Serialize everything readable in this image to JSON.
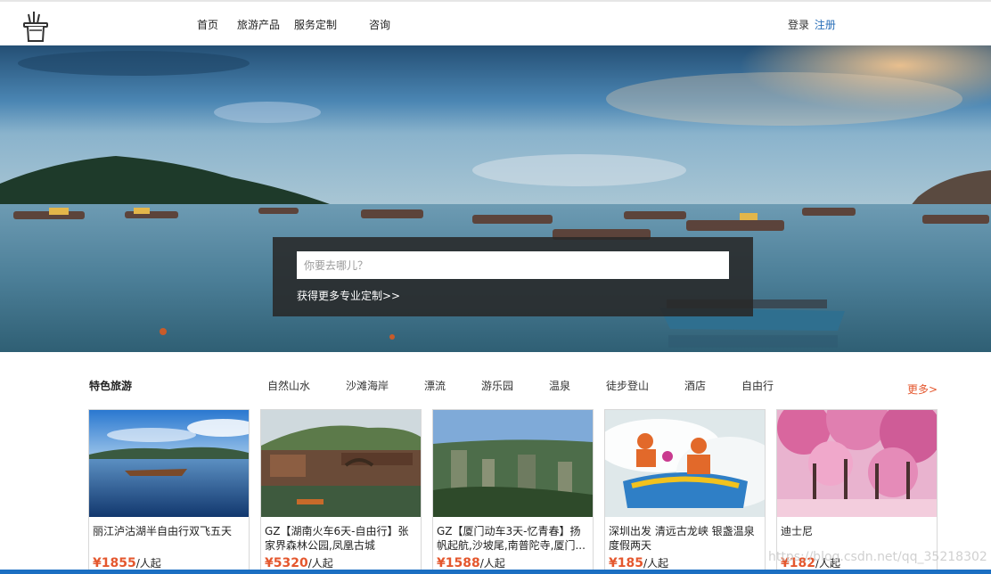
{
  "header": {
    "logo_icon": "magic-hat-icon",
    "nav": [
      "首页",
      "旅游产品",
      "服务定制",
      "咨询"
    ],
    "login": "登录",
    "register": "注册"
  },
  "hero": {
    "search_placeholder": "你要去哪儿？",
    "more_custom": "获得更多专业定制>>"
  },
  "section": {
    "title": "特色旅游",
    "categories": [
      "自然山水",
      "沙滩海岸",
      "漂流",
      "游乐园",
      "温泉",
      "徒步登山",
      "酒店",
      "自由行"
    ],
    "more": "更多>"
  },
  "cards": [
    {
      "title": "丽江泸沽湖半自由行双飞五天",
      "price": "¥1855",
      "unit": "/人起"
    },
    {
      "title": "GZ【湖南火车6天-自由行】张家界森林公园,凤凰古城",
      "price": "¥5320",
      "unit": "/人起"
    },
    {
      "title": "GZ【厦门动车3天-忆青春】扬帆起航,沙坡尾,南普陀寺,厦门...",
      "price": "¥1588",
      "unit": "/人起"
    },
    {
      "title": "深圳出发 清远古龙峡 银盏温泉度假两天",
      "price": "¥185",
      "unit": "/人起"
    },
    {
      "title": "迪士尼",
      "price": "¥182",
      "unit": "/人起"
    }
  ],
  "watermark": "https://blog.csdn.net/qq_35218302",
  "colors": {
    "accent": "#e4572e",
    "link": "#2a6fb8",
    "overlay": "#282828"
  }
}
